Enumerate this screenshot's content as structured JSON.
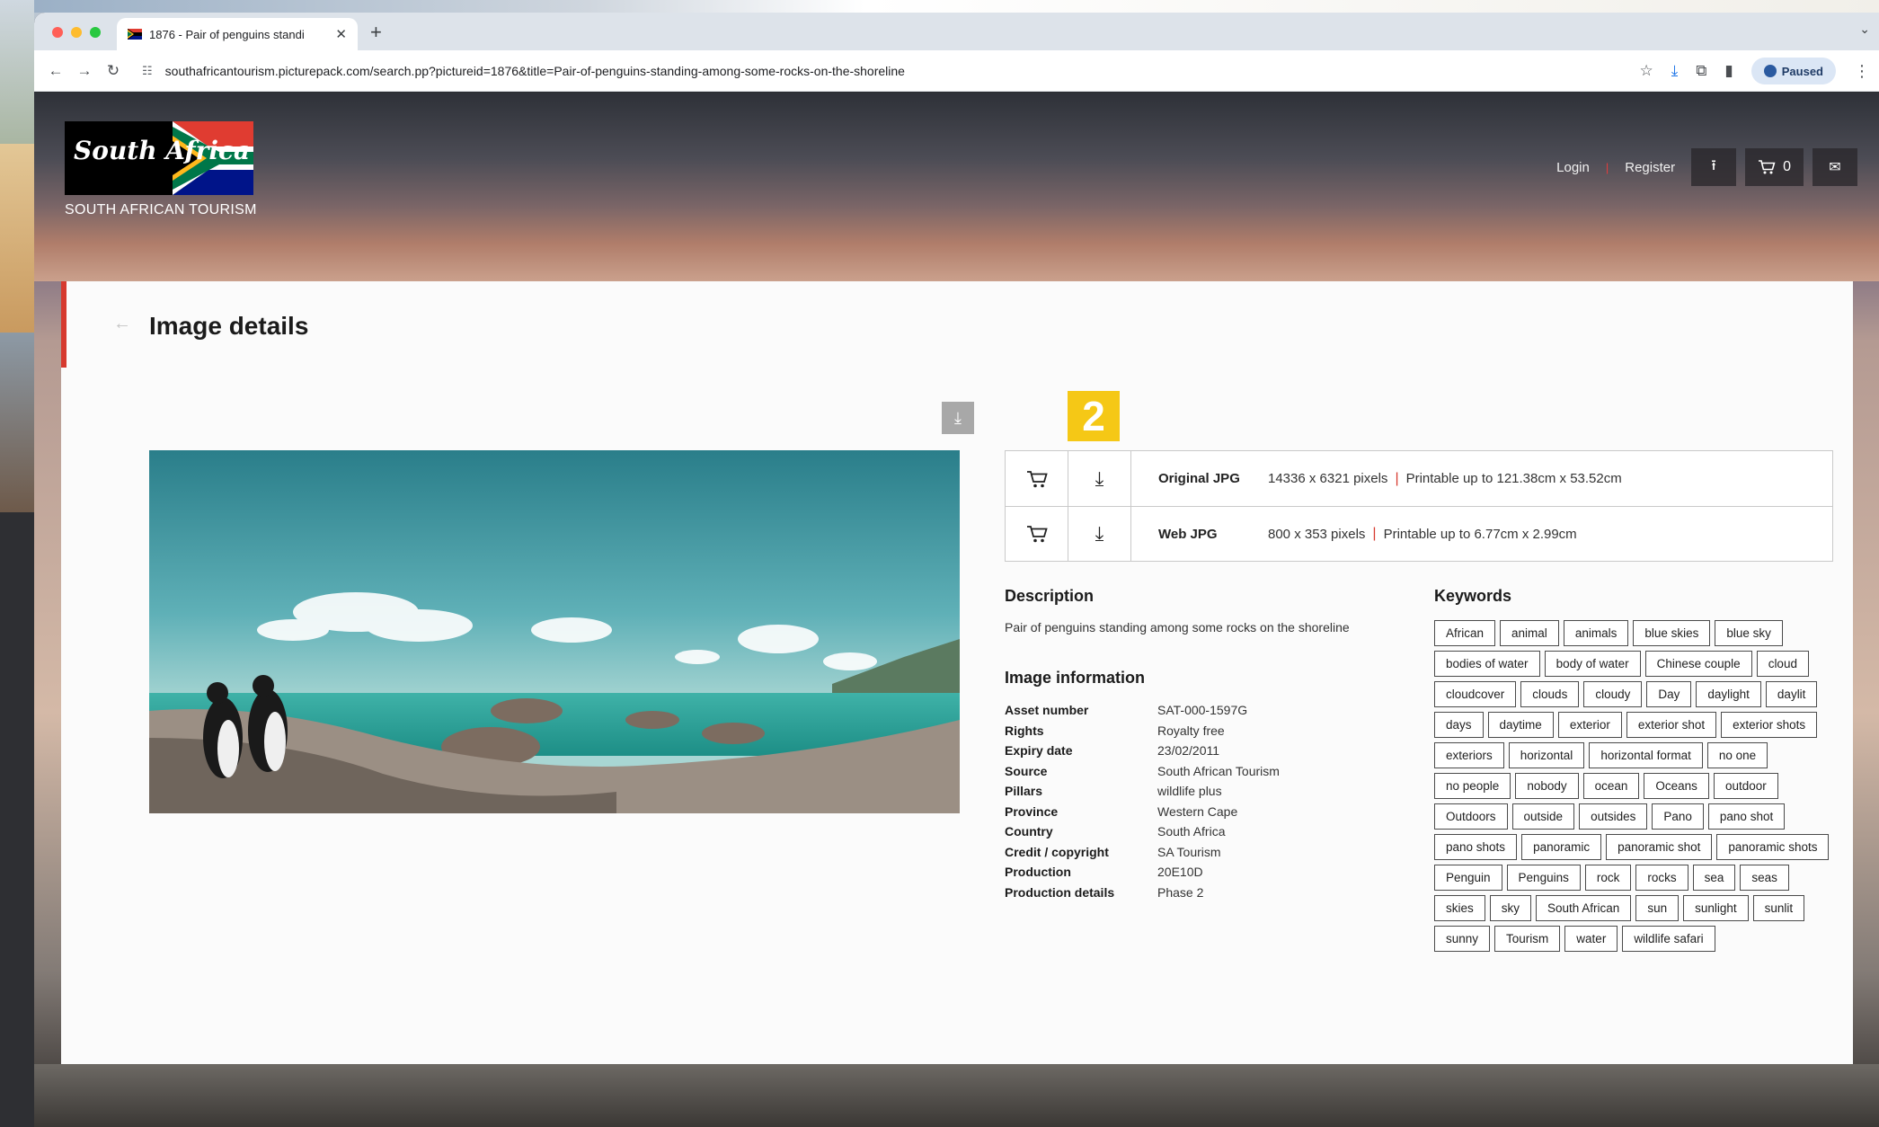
{
  "browser": {
    "tab_title": "1876 - Pair of penguins standi",
    "new_tab": "+",
    "close": "✕",
    "url": "southafricantourism.picturepack.com/search.pp?pictureid=1876&title=Pair-of-penguins-standing-among-some-rocks-on-the-shoreline",
    "profile_label": "Paused"
  },
  "header": {
    "logo_script": "South Africa",
    "logo_subtitle": "SOUTH AFRICAN TOURISM",
    "login": "Login",
    "register": "Register",
    "cart_count": "0"
  },
  "page": {
    "title": "Image details",
    "badge": "2"
  },
  "downloads": [
    {
      "name": "Original JPG",
      "dims": "14336 x 6321 pixels",
      "print": "Printable up to 121.38cm x 53.52cm"
    },
    {
      "name": "Web JPG",
      "dims": "800 x 353 pixels",
      "print": "Printable up to 6.77cm x 2.99cm"
    }
  ],
  "description": {
    "heading": "Description",
    "text": "Pair of penguins standing among some rocks on the shoreline"
  },
  "image_info": {
    "heading": "Image information",
    "rows": [
      {
        "k": "Asset number",
        "v": "SAT-000-1597G"
      },
      {
        "k": "Rights",
        "v": "Royalty free"
      },
      {
        "k": "Expiry date",
        "v": "23/02/2011"
      },
      {
        "k": "Source",
        "v": "South African Tourism"
      },
      {
        "k": "Pillars",
        "v": "wildlife plus"
      },
      {
        "k": "Province",
        "v": "Western Cape"
      },
      {
        "k": "Country",
        "v": "South Africa"
      },
      {
        "k": "Credit / copyright",
        "v": "SA Tourism"
      },
      {
        "k": "Production",
        "v": "20E10D"
      },
      {
        "k": "Production details",
        "v": "Phase 2"
      }
    ]
  },
  "keywords": {
    "heading": "Keywords",
    "items": [
      "African",
      "animal",
      "animals",
      "blue skies",
      "blue sky",
      "bodies of water",
      "body of water",
      "Chinese couple",
      "cloud",
      "cloudcover",
      "clouds",
      "cloudy",
      "Day",
      "daylight",
      "daylit",
      "days",
      "daytime",
      "exterior",
      "exterior shot",
      "exterior shots",
      "exteriors",
      "horizontal",
      "horizontal format",
      "no one",
      "no people",
      "nobody",
      "ocean",
      "Oceans",
      "outdoor",
      "Outdoors",
      "outside",
      "outsides",
      "Pano",
      "pano shot",
      "pano shots",
      "panoramic",
      "panoramic shot",
      "panoramic shots",
      "Penguin",
      "Penguins",
      "rock",
      "rocks",
      "sea",
      "seas",
      "skies",
      "sky",
      "South African",
      "sun",
      "sunlight",
      "sunlit",
      "sunny",
      "Tourism",
      "water",
      "wildlife safari"
    ]
  },
  "colors": {
    "accent_red": "#d63a2f",
    "badge_yellow": "#f5c816",
    "card_bg": "#fbfbfb"
  }
}
